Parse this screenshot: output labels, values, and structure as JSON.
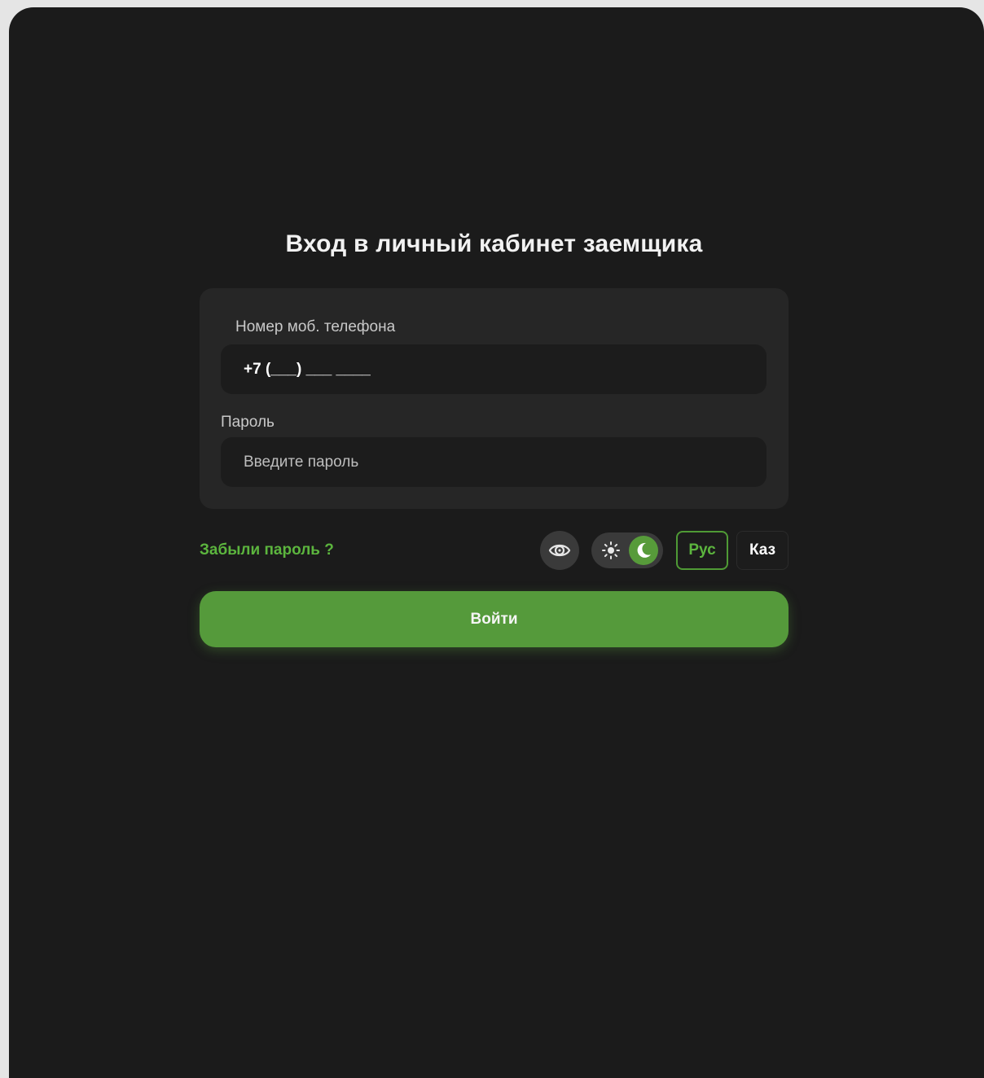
{
  "page": {
    "title": "Вход в личный кабинет заемщика"
  },
  "form": {
    "phone_label": "Номер моб. телефона",
    "phone_value": "+7 (___) ___ ____",
    "password_label": "Пароль",
    "password_placeholder": "Введите пароль",
    "password_value": ""
  },
  "controls": {
    "forgot_password": "Забыли пароль ?",
    "show_password_icon": "eye-icon",
    "theme": {
      "light_icon": "sun-icon",
      "dark_icon": "moon-icon",
      "selected": "dark"
    },
    "languages": [
      {
        "label": "Рус",
        "active": true
      },
      {
        "label": "Каз",
        "active": false
      }
    ]
  },
  "submit": {
    "label": "Войти"
  },
  "colors": {
    "background": "#1b1b1b",
    "card": "#262626",
    "field": "#1c1c1c",
    "accent": "#559a3b",
    "accent_text": "#5cb53e"
  }
}
